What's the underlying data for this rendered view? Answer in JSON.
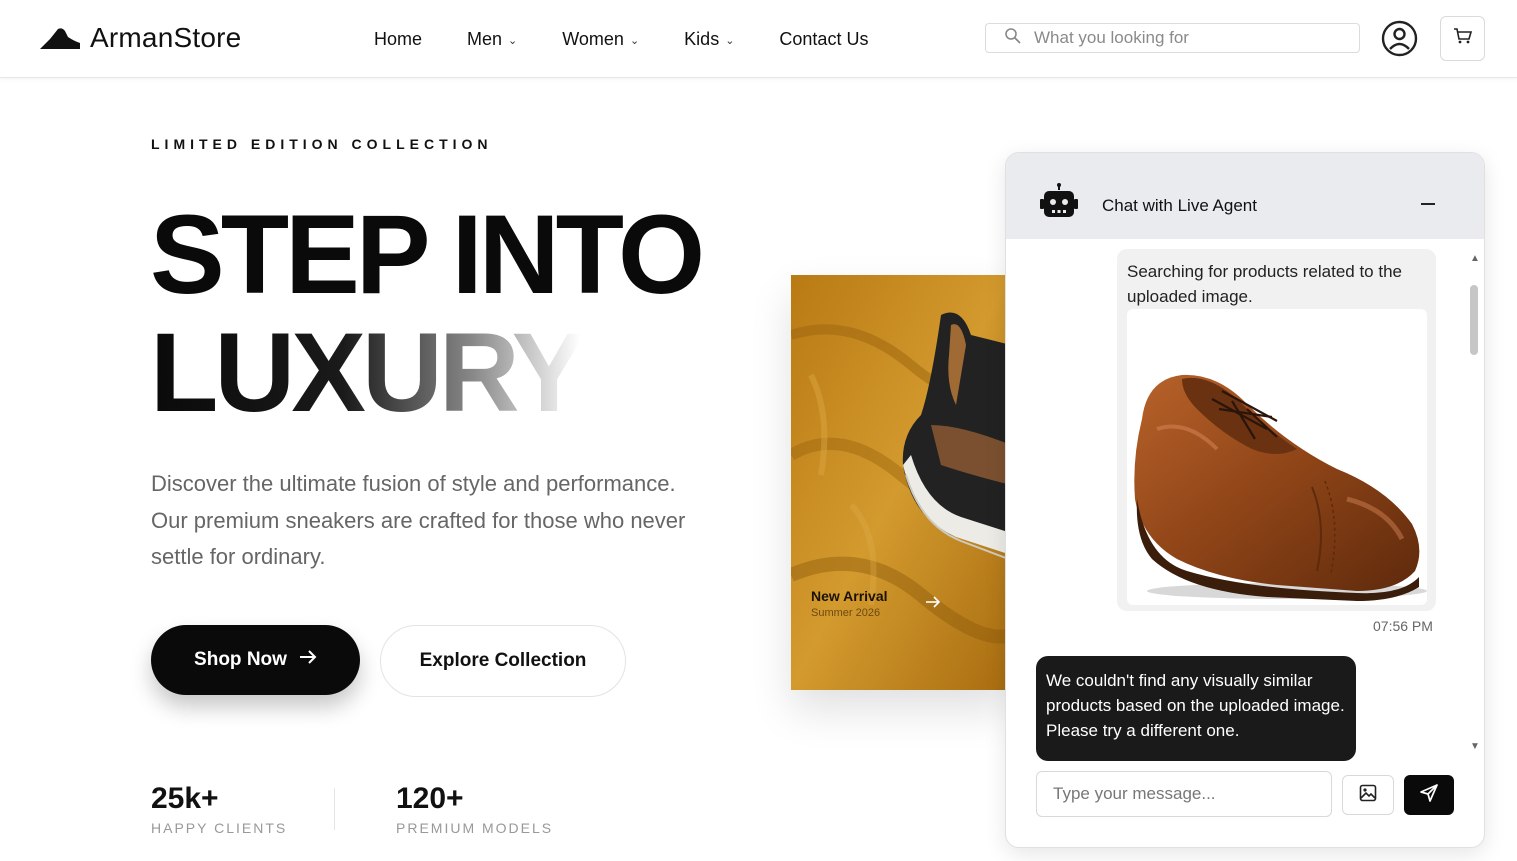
{
  "header": {
    "logo_text": "ArmanStore",
    "nav": [
      "Home",
      "Men",
      "Women",
      "Kids",
      "Contact Us"
    ],
    "search_placeholder": "What you looking for",
    "icons": {
      "search": "search-icon",
      "user": "user-circle-icon",
      "cart": "cart-icon",
      "logo": "shoe-logo-icon"
    }
  },
  "hero": {
    "eyebrow": "LIMITED EDITION COLLECTION",
    "title_line1": "STEP INTO",
    "title_line2": "LUXURY",
    "description": "Discover the ultimate fusion of style and performance. Our premium sneakers are crafted for those who never settle for ordinary.",
    "primary_button": "Shop Now",
    "secondary_button": "Explore Collection",
    "stats": [
      {
        "value": "25k+",
        "label": "HAPPY CLIENTS"
      },
      {
        "value": "120+",
        "label": "PREMIUM MODELS"
      }
    ]
  },
  "product_card": {
    "title": "New Arrival",
    "subtitle": "Summer 2026"
  },
  "chat": {
    "title": "Chat with Live Agent",
    "user_message": "Searching for products related to the uploaded image.",
    "user_time": "07:56 PM",
    "bot_message": "We couldn't find any visually similar products based on the uploaded image. Please try a different one.",
    "input_placeholder": "Type your message...",
    "icons": {
      "bot": "robot-icon",
      "minimize": "minimize-icon",
      "image": "image-upload-icon",
      "send": "send-icon"
    }
  },
  "colors": {
    "primary": "#0a0a0a",
    "card_bg": "#c98a1f",
    "chat_header_bg": "#e9ebef",
    "bot_bubble": "#1a1a1a"
  }
}
